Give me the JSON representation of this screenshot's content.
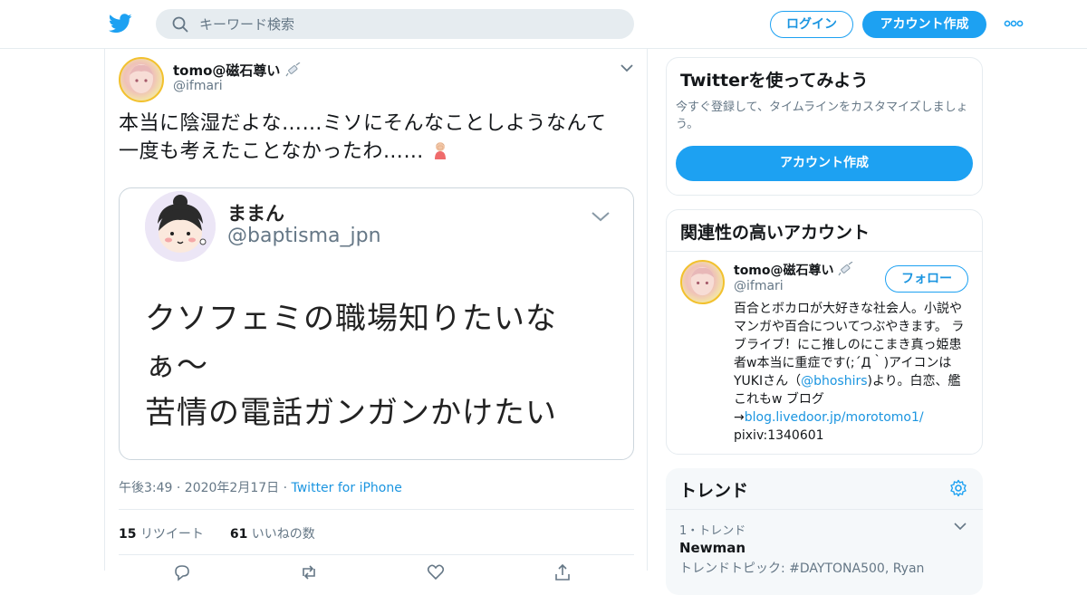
{
  "header": {
    "search_placeholder": "キーワード検索",
    "login_label": "ログイン",
    "signup_label": "アカウント作成"
  },
  "tweet": {
    "author_name": "tomo@磁石尊い",
    "author_handle": "@ifmari",
    "text": "本当に陰湿だよな……ミソにそんなことしようなんて一度も考えたことなかったわ……",
    "quoted_image": {
      "name": "ままん",
      "handle": "@baptisma_jpn",
      "lines": [
        "クソフェミの職場知りたいな",
        "ぁ〜",
        "苦情の電話ガンガンかけたい"
      ]
    },
    "timestamp": "午後3:49 · 2020年2月17日 · ",
    "source": "Twitter for iPhone",
    "retweet_count": "15",
    "retweet_label": "リツイート",
    "like_count": "61",
    "like_label": "いいねの数"
  },
  "sidebar": {
    "signup_card": {
      "title": "Twitterを使ってみよう",
      "subtitle": "今すぐ登録して、タイムラインをカスタマイズしましょう。",
      "button": "アカウント作成"
    },
    "related": {
      "title": "関連性の高いアカウント",
      "name": "tomo@磁石尊い",
      "handle": "@ifmari",
      "follow": "フォロー",
      "bio_part1": "百合とボカロが大好きな社会人。小説やマンガや百合についてつぶやきます。 ラブライブ！にこ推しのにこまき真っ姫患者w本当に重症です(;´Д｀)アイコンはYUKIさん（",
      "bio_mention": "@bhoshirs",
      "bio_part2": ")より。白恋、艦これもw ブログ→",
      "bio_link": "blog.livedoor.jp/morotomo1/",
      "bio_part3": " pixiv:1340601"
    },
    "trends": {
      "title": "トレンド",
      "rank": "1・トレンド",
      "name": "Newman",
      "topic": "トレンドトピック: #DAYTONA500, Ryan"
    }
  },
  "colors": {
    "accent": "#1da1f2",
    "link": "#1b95e0",
    "muted": "#657786"
  }
}
